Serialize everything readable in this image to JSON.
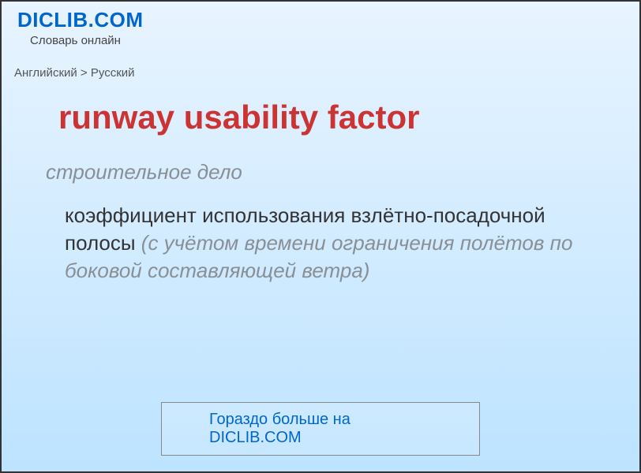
{
  "header": {
    "site_title": "DICLIB.COM",
    "tagline": "Словарь онлайн"
  },
  "breadcrumb": "Английский > Русский",
  "entry": {
    "term": "runway usability factor",
    "category": "строительное дело",
    "definition_main": "коэффициент использования взлётно-посадочной полосы",
    "definition_note": " (с учётом времени ограничения полётов по боковой составляющей ветра)"
  },
  "footer": {
    "more_label": "Гораздо больше на DICLIB.COM"
  }
}
